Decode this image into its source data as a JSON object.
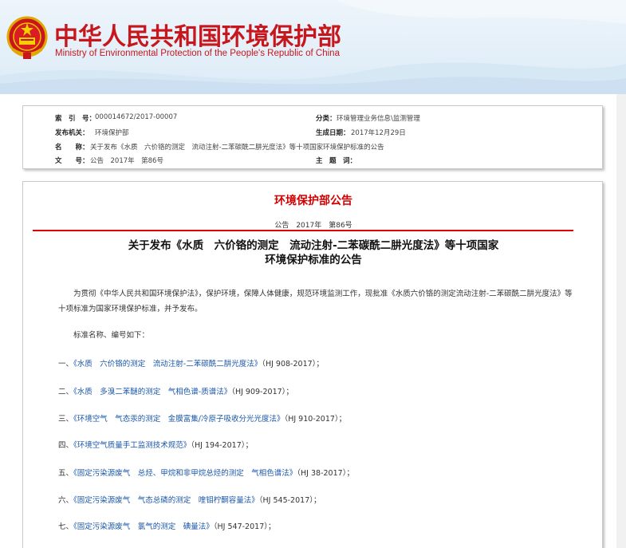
{
  "header": {
    "title_cn": "中华人民共和国环境保护部",
    "title_en": "Ministry of Environmental Protection of the People's Republic of China"
  },
  "meta": {
    "index_label": "索　引　号：",
    "index_value": "000014672/2017-00007",
    "category_label": "分类：",
    "category_value": "环境管理业务信息\\监测管理",
    "issuer_label": "发布机关：",
    "issuer_value": "环境保护部",
    "date_label": "生成日期：",
    "date_value": "2017年12月29日",
    "name_label": "名　　称：",
    "name_value": "关于发布《水质　六价铬的测定　流动注射-二苯碳酰二肼光度法》等十项国家环境保护标准的公告",
    "docno_label": "文　　号：",
    "docno_value": "公告　2017年　第86号",
    "subject_label": "主　题　词：",
    "subject_value": ""
  },
  "article": {
    "heading": "环境保护部公告",
    "docno": "公告　2017年　第86号",
    "title_line1": "关于发布《水质　六价铬的测定　流动注射-二苯碳酰二肼光度法》等十项国家",
    "title_line2": "环境保护标准的公告",
    "intro": "为贯彻《中华人民共和国环境保护法》，保护环境，保障人体健康，规范环境监测工作，现批准《水质六价铬的测定流动注射-二苯碳酰二肼光度法》等十项标准为国家环境保护标准，并予发布。",
    "list_intro": "标准名称、编号如下：",
    "standards": [
      {
        "num": "一、",
        "name": "《水质　六价铬的测定　流动注射-二苯碳酰二肼光度法》",
        "code": "（HJ 908-2017）；"
      },
      {
        "num": "二、",
        "name": "《水质　多溴二苯醚的测定　气相色谱-质谱法》",
        "code": "（HJ 909-2017）；"
      },
      {
        "num": "三、",
        "name": "《环境空气　气态汞的测定　金膜富集/冷原子吸收分光光度法》",
        "code": "（HJ 910-2017）；"
      },
      {
        "num": "四、",
        "name": "《环境空气质量手工监测技术规范》",
        "code": "（HJ 194-2017）；"
      },
      {
        "num": "五、",
        "name": "《固定污染源废气　总烃、甲烷和非甲烷总烃的测定　气相色谱法》",
        "code": "（HJ 38-2017）；"
      },
      {
        "num": "六、",
        "name": "《固定污染源废气　气态总磷的测定　喹钼柠酮容量法》",
        "code": "（HJ 545-2017）；"
      },
      {
        "num": "七、",
        "name": "《固定污染源废气　氯气的测定　碘量法》",
        "code": "（HJ 547-2017）；"
      }
    ]
  },
  "colors": {
    "brand_red": "#c8161d",
    "link_blue": "#1a57a8",
    "rule_red": "#e00000"
  },
  "icons": {
    "emblem": "national-emblem-icon"
  }
}
